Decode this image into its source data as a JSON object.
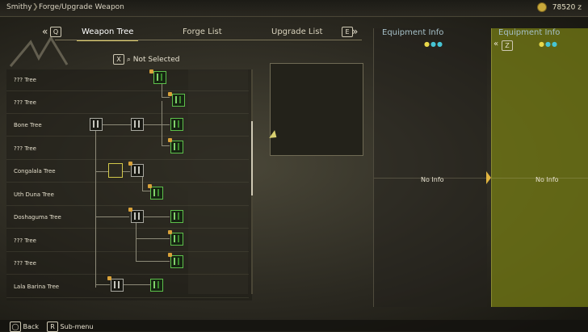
{
  "breadcrumb": {
    "root": "Smithy",
    "separator": "❯",
    "current": "Forge/Upgrade Weapon"
  },
  "currency": {
    "amount": "78520",
    "unit": "z"
  },
  "tabs": {
    "prev_key": "Q",
    "next_key": "E",
    "items": [
      "Weapon Tree",
      "Forge List",
      "Upgrade List"
    ],
    "active": "Weapon Tree"
  },
  "filter": {
    "key": "X",
    "label": "Not Selected"
  },
  "trees": [
    "??? Tree",
    "??? Tree",
    "Bone Tree",
    "??? Tree",
    "Congalala Tree",
    "Uth Duna Tree",
    "Doshaguma Tree",
    "??? Tree",
    "??? Tree",
    "Lala Barina Tree"
  ],
  "equipment_panels": [
    {
      "title": "Equipment Info",
      "status": "No Info"
    },
    {
      "title": "Equipment Info",
      "key": "Z",
      "status": "No Info"
    }
  ],
  "bottom": {
    "back_label": "Back",
    "submenu_key": "R",
    "submenu_label": "Sub-menu"
  },
  "colors": {
    "accent": "#d8c86a",
    "highlight_panel": "#767c14",
    "node_green": "#5cbf4a"
  }
}
